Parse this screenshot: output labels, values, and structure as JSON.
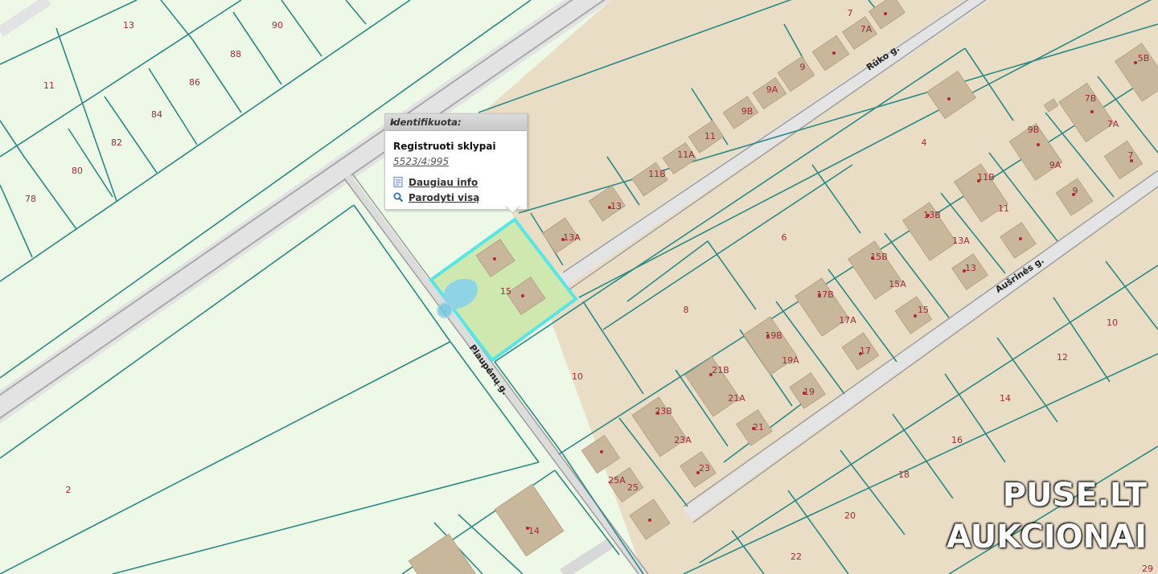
{
  "map": {
    "parcel_numbers": [
      "13",
      "90",
      "88",
      "86",
      "84",
      "82",
      "80",
      "78",
      "11",
      "2",
      "13A",
      "13",
      "11B",
      "11A",
      "11",
      "9B",
      "9A",
      "9",
      "7",
      "7A",
      "4",
      "6",
      "8",
      "10",
      "15",
      "5B",
      "7B",
      "7A",
      "7",
      "9B",
      "9A",
      "9",
      "11B",
      "11",
      "13B",
      "13A",
      "13",
      "15B",
      "15A",
      "15",
      "17B",
      "17A",
      "17",
      "19B",
      "19A",
      "19",
      "21B",
      "21A",
      "21",
      "23B",
      "23A",
      "23",
      "25A",
      "25",
      "14",
      "10",
      "12",
      "14",
      "16",
      "18",
      "20",
      "22",
      "29"
    ],
    "streets": [
      "Rūko g.",
      "Aušrinės g.",
      "Plaupėnų g."
    ],
    "selected_parcel_number": "15"
  },
  "popup": {
    "title": "Identifikuota:",
    "close_label": "×",
    "heading": "Registruoti sklypai",
    "parcel_id": "5523/4:995",
    "more_info_label": "Daugiau info",
    "show_all_label": "Parodyti visą"
  },
  "watermark": {
    "line1": "PUSE.LT",
    "line2": "AUKCIONAI"
  },
  "colors": {
    "background": "#eef8e6",
    "plot_outline": "#2a8a86",
    "plot_fill": "#eaddc6",
    "building": "#c9b79c",
    "selected_outline": "#55e6e6",
    "selected_fill": "#cfe8b0",
    "road": "#d9d9d9"
  }
}
